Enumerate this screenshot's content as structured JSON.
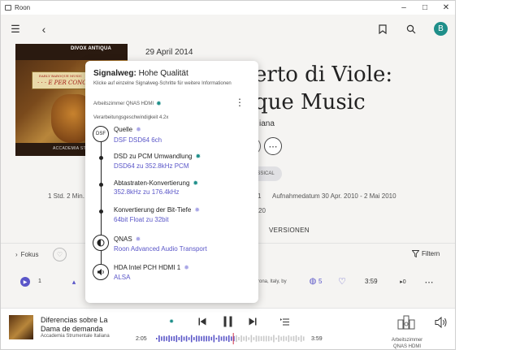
{
  "window": {
    "title": "Roon"
  },
  "header": {
    "avatar_letter": "B"
  },
  "album": {
    "date": "29 April 2014",
    "title_line1": "erto di Viole:",
    "title_line2": "que Music",
    "artist_fragment": "iana",
    "genre_fragment": "SSICAL",
    "meta_left": "1 Std. 2 Min.",
    "meta_recording": "Aufnahmedatum 30 Apr. 2010 - 2 Mai 2010",
    "meta_year_fragment": "20",
    "meta_one": "1",
    "tab_versions": "VERSIONEN",
    "cover": {
      "label": "DIVOX ANTIQUA",
      "banner_small": "EARLY BAROQUE MUSIC",
      "banner_big": "· · · E PER CONCERTO",
      "footer": "ACCADEMIA STRUMENTALE"
    }
  },
  "toolbar": {
    "focus_label": "Fokus",
    "filter_label": "Filtern"
  },
  "track_row": {
    "number": "1",
    "place_fragment": "rona, Italy, by",
    "versions_count": "5",
    "duration": "3:59"
  },
  "signal_path": {
    "title_prefix": "Signalweg:",
    "quality": "Hohe Qualität",
    "subtitle": "Klicke auf einzelne Signalweg-Schritte für weitere Informationen",
    "zone_name": "Arbeitszimmer QNAS HDMI",
    "speed": "Verarbeitungsgeschwindigkeit 4.2x",
    "steps": [
      {
        "name": "Quelle",
        "value": "DSF DSD64 6ch",
        "badge": "DSF"
      },
      {
        "name": "DSD zu PCM Umwandlung",
        "value": "DSD64 zu 352.8kHz PCM"
      },
      {
        "name": "Abtastraten-Konvertierung",
        "value": "352.8kHz zu 176.4kHz"
      },
      {
        "name": "Konvertierung der Bit-Tiefe",
        "value": "64bit Float zu 32bit"
      },
      {
        "name": "QNAS",
        "value": "Roon Advanced Audio Transport"
      },
      {
        "name": "HDA Intel PCH HDMI 1",
        "value": "ALSA"
      }
    ]
  },
  "now_playing": {
    "title": "Diferencias sobre La Dama de demanda",
    "artist": "Accademia Strumentale Italiana",
    "elapsed": "2:05",
    "total": "3:59",
    "progress_fraction": 0.52,
    "zone_line1": "Arbeitszimmer",
    "zone_line2": "QNAS HDMI"
  },
  "colors": {
    "accent": "#5a56c8",
    "teal": "#1f8f8a",
    "progress": "#d0344a"
  }
}
